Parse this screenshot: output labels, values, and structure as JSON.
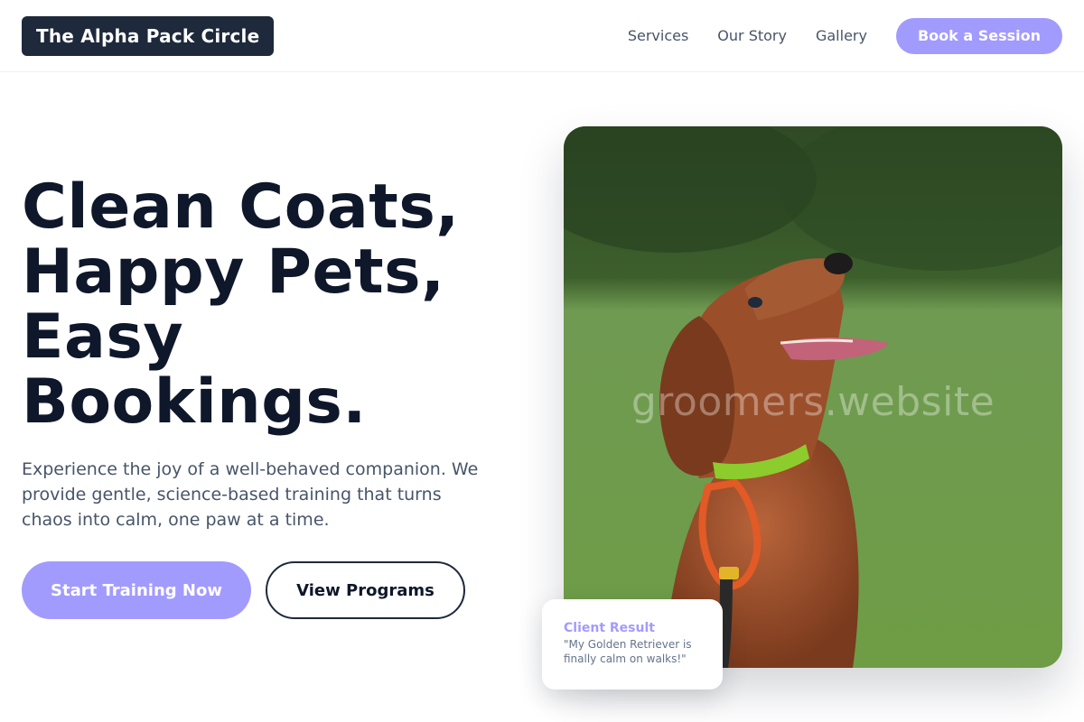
{
  "header": {
    "brand": "The Alpha Pack Circle",
    "nav": [
      {
        "label": "Services"
      },
      {
        "label": "Our Story"
      },
      {
        "label": "Gallery"
      }
    ],
    "cta_label": "Book a Session"
  },
  "hero": {
    "title_lines": [
      "Clean Coats,",
      "Happy Pets,",
      "Easy",
      "Bookings."
    ],
    "subtitle": "Experience the joy of a well-behaved companion. We provide gentle, science-based training that turns chaos into calm, one paw at a time.",
    "primary_cta": "Start Training Now",
    "secondary_cta": "View Programs"
  },
  "image": {
    "subject": "dog-photo",
    "watermark": "groomers.website"
  },
  "testimonial": {
    "title": "Client Result",
    "quote": "\"My Golden Retriever is finally calm on walks!\""
  },
  "colors": {
    "accent": "#a29bfe",
    "brand_bg": "#1e293b",
    "heading": "#0f172a",
    "body_text": "#475569"
  }
}
